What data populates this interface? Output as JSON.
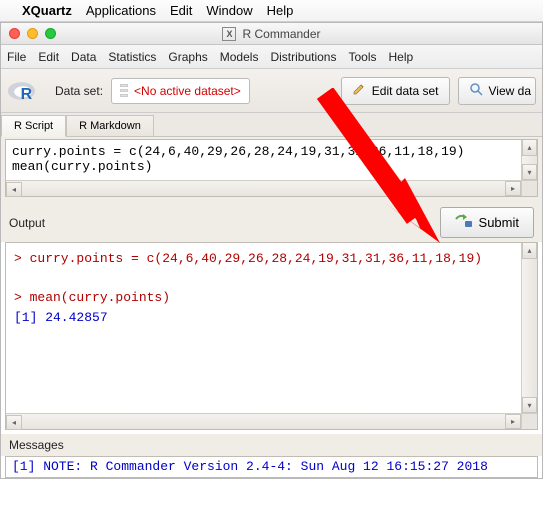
{
  "mac_menu": {
    "items": [
      "XQuartz",
      "Applications",
      "Edit",
      "Window",
      "Help"
    ]
  },
  "window": {
    "title": "R Commander"
  },
  "app_menu": {
    "items": [
      "File",
      "Edit",
      "Data",
      "Statistics",
      "Graphs",
      "Models",
      "Distributions",
      "Tools",
      "Help"
    ]
  },
  "toolbar": {
    "dataset_label": "Data set:",
    "dataset_value": "<No active dataset>",
    "edit_btn": "Edit data set",
    "view_btn": "View da"
  },
  "tabs": {
    "script": "R Script",
    "markdown": "R Markdown"
  },
  "script": {
    "line1": "curry.points = c(24,6,40,29,26,28,24,19,31,31,36,11,18,19)",
    "line2": "mean(curry.points)"
  },
  "output": {
    "label": "Output",
    "submit": "Submit",
    "cmd1": "> curry.points = c(24,6,40,29,26,28,24,19,31,31,36,11,18,19)",
    "cmd2": "> mean(curry.points)",
    "result": "[1] 24.42857"
  },
  "messages": {
    "label": "Messages",
    "line": "[1] NOTE: R Commander Version 2.4-4: Sun Aug 12 16:15:27 2018"
  }
}
